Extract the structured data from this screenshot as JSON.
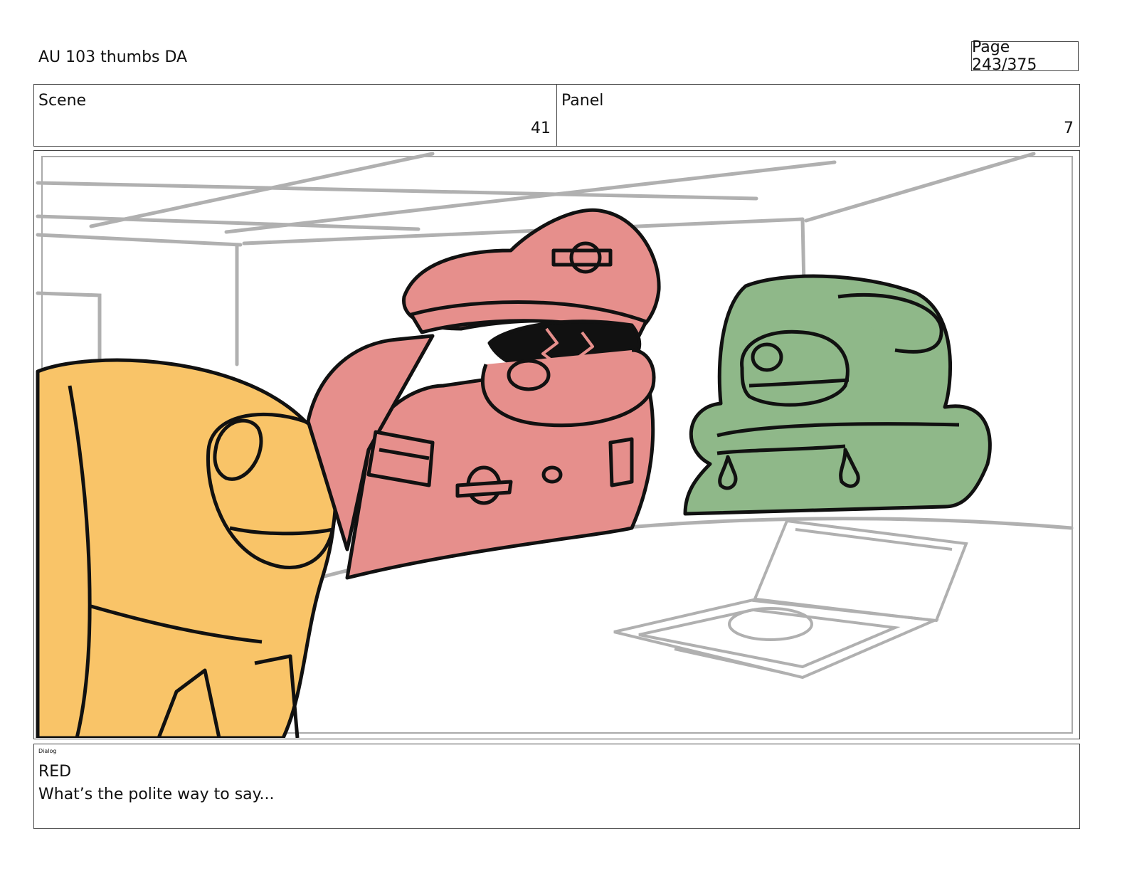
{
  "header": {
    "title": "AU 103 thumbs DA",
    "page_label": "Page 243/375"
  },
  "scene_info": {
    "scene_label": "Scene",
    "scene_value": "41",
    "panel_label": "Panel",
    "panel_value": "7"
  },
  "dialog": {
    "heading": "Dialog",
    "character": "RED",
    "line": "What’s the polite way to say..."
  },
  "colors": {
    "yellow_character": "#f9c468",
    "red_character": "#e68f8c",
    "green_character": "#8fb889",
    "background_lines": "#b0b0b0",
    "ink": "#111111"
  }
}
